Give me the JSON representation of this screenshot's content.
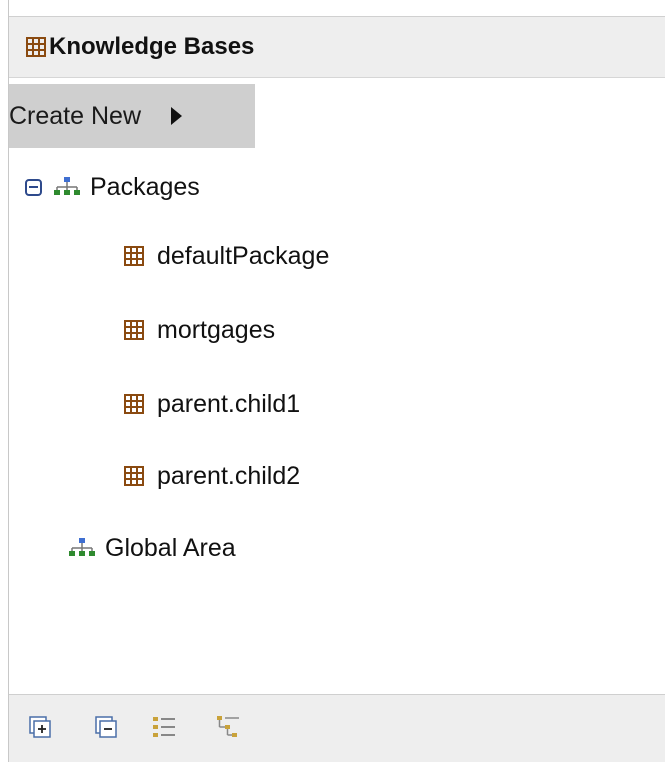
{
  "header": {
    "title": "Knowledge Bases",
    "icon": "package-icon"
  },
  "menu": {
    "create_new_label": "Create New",
    "arrow_icon": "triangle-right-icon"
  },
  "tree": {
    "root": {
      "label": "Packages",
      "expanded": true,
      "icon": "hierarchy-icon"
    },
    "children": [
      {
        "label": "defaultPackage",
        "icon": "package-icon"
      },
      {
        "label": "mortgages",
        "icon": "package-icon"
      },
      {
        "label": "parent.child1",
        "icon": "package-icon"
      },
      {
        "label": "parent.child2",
        "icon": "package-icon"
      }
    ],
    "global": {
      "label": "Global Area",
      "icon": "hierarchy-icon"
    }
  },
  "toolbar": {
    "buttons": [
      "expand-all-icon",
      "collapse-all-icon",
      "list-view-icon",
      "tree-view-icon"
    ]
  },
  "colors": {
    "package_icon": "#8a4a10",
    "hierarchy_blue": "#3f6fd1",
    "hierarchy_green": "#2f8a2f",
    "create_new_bg": "#cfcfcf"
  }
}
